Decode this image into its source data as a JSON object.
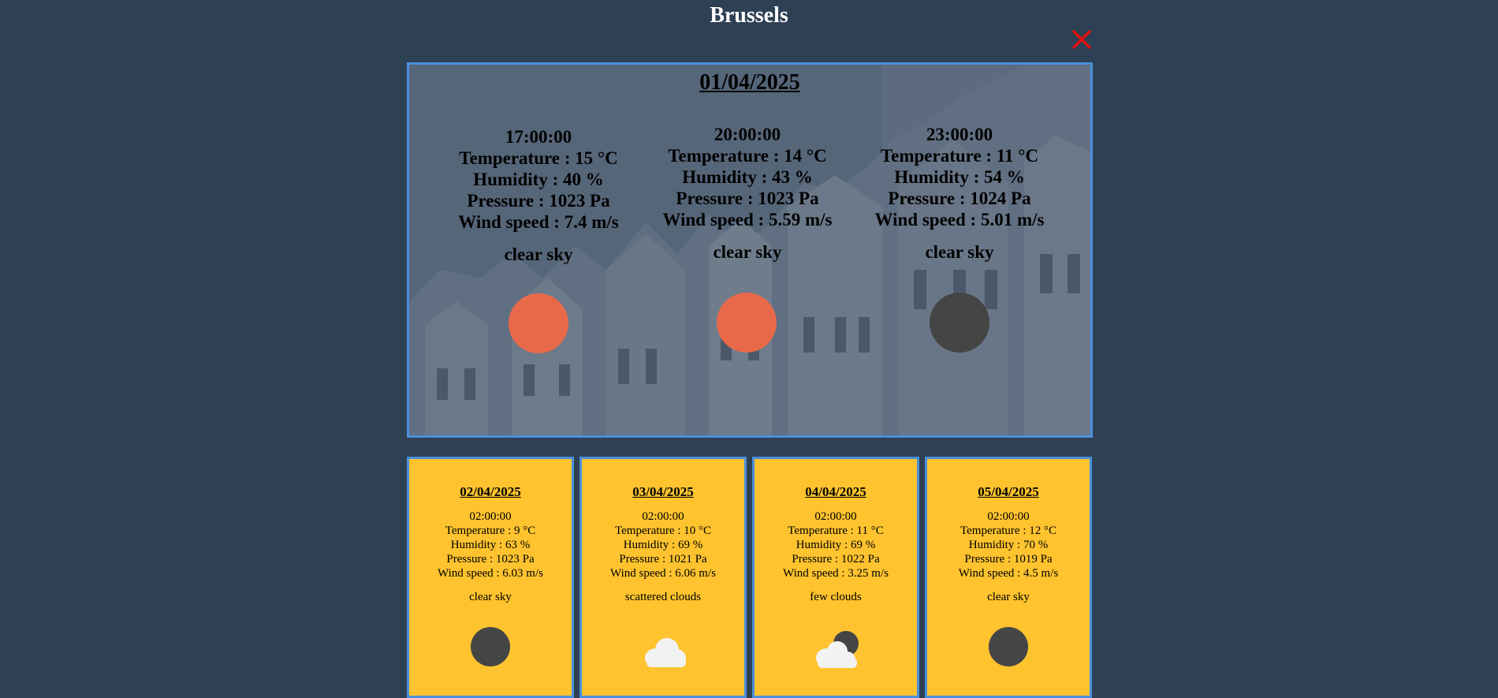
{
  "city": "Brussels",
  "colors": {
    "background": "#2e4053",
    "card": "#fec32e",
    "border": "#4a8fdc",
    "sun": "#e8694a",
    "moon": "#454545",
    "close": "#e01010"
  },
  "close_icon": "close-icon",
  "today": {
    "date": "01/04/2025",
    "slots": [
      {
        "time": "17:00:00",
        "temperature": "Temperature : 15 °C",
        "humidity": "Humidity : 40 %",
        "pressure": "Pressure : 1023 Pa",
        "wind": "Wind speed : 7.4 m/s",
        "description": "clear sky",
        "icon": "sun-icon"
      },
      {
        "time": "20:00:00",
        "temperature": "Temperature : 14 °C",
        "humidity": "Humidity : 43 %",
        "pressure": "Pressure : 1023 Pa",
        "wind": "Wind speed : 5.59 m/s",
        "description": "clear sky",
        "icon": "sun-icon"
      },
      {
        "time": "23:00:00",
        "temperature": "Temperature : 11 °C",
        "humidity": "Humidity : 54 %",
        "pressure": "Pressure : 1024 Pa",
        "wind": "Wind speed : 5.01 m/s",
        "description": "clear sky",
        "icon": "moon-icon"
      }
    ]
  },
  "forecast": [
    {
      "date": "02/04/2025",
      "time": "02:00:00",
      "temperature": "Temperature : 9 °C",
      "humidity": "Humidity : 63 %",
      "pressure": "Pressure : 1023 Pa",
      "wind": "Wind speed : 6.03 m/s",
      "description": "clear sky",
      "icon": "moon-icon"
    },
    {
      "date": "03/04/2025",
      "time": "02:00:00",
      "temperature": "Temperature : 10 °C",
      "humidity": "Humidity : 69 %",
      "pressure": "Pressure : 1021 Pa",
      "wind": "Wind speed : 6.06 m/s",
      "description": "scattered clouds",
      "icon": "cloud-icon"
    },
    {
      "date": "04/04/2025",
      "time": "02:00:00",
      "temperature": "Temperature : 11 °C",
      "humidity": "Humidity : 69 %",
      "pressure": "Pressure : 1022 Pa",
      "wind": "Wind speed : 3.25 m/s",
      "description": "few clouds",
      "icon": "cloud-moon-icon"
    },
    {
      "date": "05/04/2025",
      "time": "02:00:00",
      "temperature": "Temperature : 12 °C",
      "humidity": "Humidity : 70 %",
      "pressure": "Pressure : 1019 Pa",
      "wind": "Wind speed : 4.5 m/s",
      "description": "clear sky",
      "icon": "moon-icon"
    }
  ]
}
